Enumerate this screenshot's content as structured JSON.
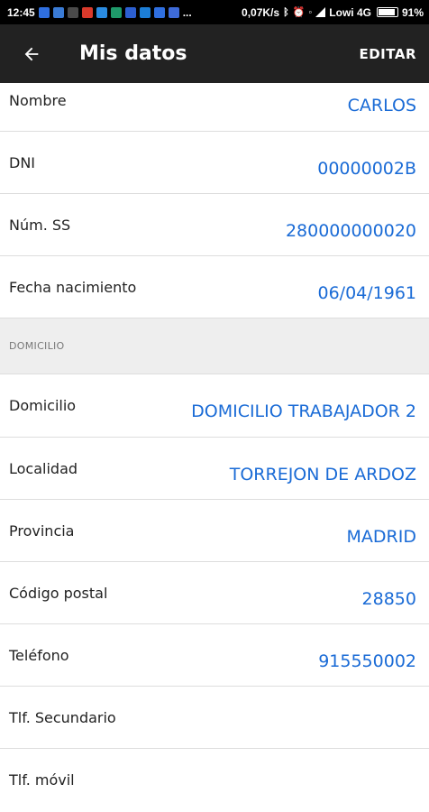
{
  "status_bar": {
    "time": "12:45",
    "net_speed": "0,07K/s",
    "carrier": "Lowi 4G",
    "battery": "91%",
    "more": "..."
  },
  "app_bar": {
    "title": "Mis datos",
    "edit_label": "EDITAR"
  },
  "personal": {
    "nombre": {
      "label": "Nombre",
      "value": "CARLOS"
    },
    "dni": {
      "label": "DNI",
      "value": "00000002B"
    },
    "num_ss": {
      "label": "Núm. SS",
      "value": "280000000020"
    },
    "fecha": {
      "label": "Fecha nacimiento",
      "value": "06/04/1961"
    }
  },
  "section_domicilio": {
    "title": "DOMICILIO"
  },
  "address": {
    "domicilio": {
      "label": "Domicilio",
      "value": "DOMICILIO TRABAJADOR 2"
    },
    "localidad": {
      "label": "Localidad",
      "value": "TORREJON DE ARDOZ"
    },
    "provincia": {
      "label": "Provincia",
      "value": "MADRID"
    },
    "codigo_postal": {
      "label": "Código postal",
      "value": "28850"
    },
    "telefono": {
      "label": "Teléfono",
      "value": "915550002"
    },
    "tlf_secundario": {
      "label": "Tlf. Secundario",
      "value": ""
    },
    "tlf_movil": {
      "label": "Tlf. móvil",
      "value": ""
    }
  },
  "colors": {
    "value_blue": "#1a6bd6",
    "app_bar": "#222222",
    "section_bg": "#eeeeee"
  }
}
